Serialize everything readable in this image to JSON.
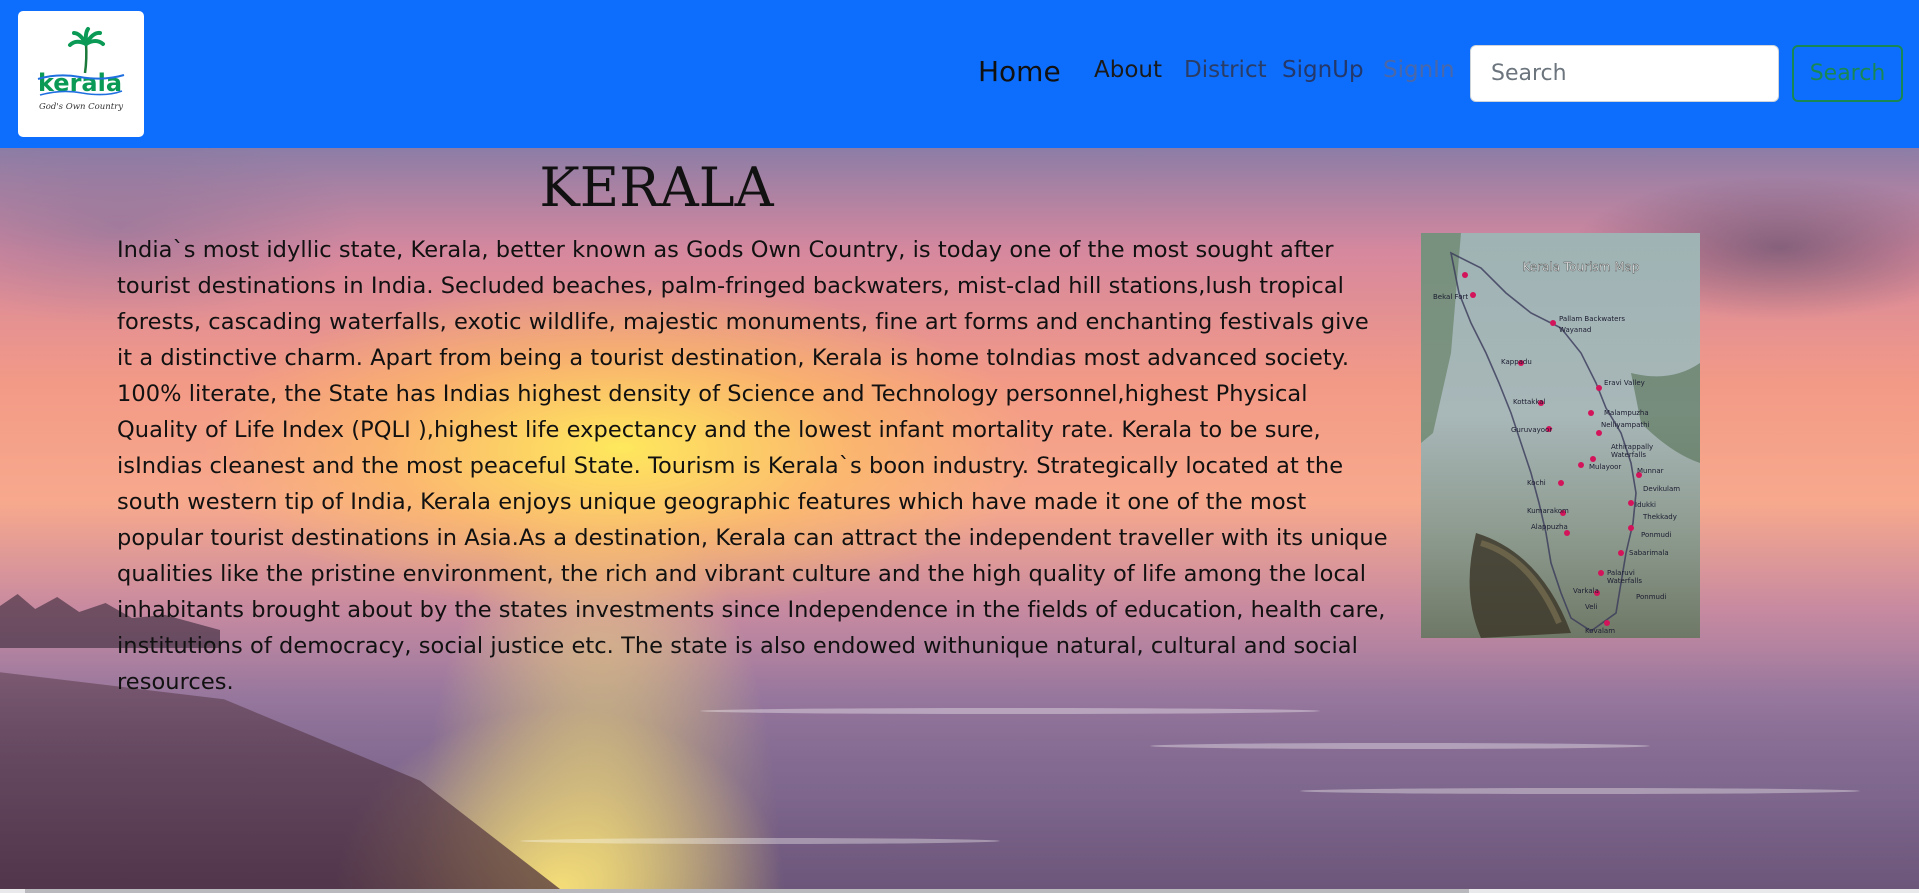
{
  "navbar": {
    "logo": {
      "text": "kerala",
      "tagline": "God's Own Country"
    },
    "links": {
      "home": "Home",
      "about": "About",
      "district": "District",
      "signup": "SignUp",
      "signin": "SignIn"
    },
    "search": {
      "placeholder": "Search",
      "value": "",
      "button_label": "Search"
    },
    "background_color": "#0d6efd"
  },
  "main": {
    "title": "KERALA",
    "description": "India`s most idyllic state, Kerala, better known as Gods Own Country, is today one of the most sought after tourist destinations in India. Secluded beaches, palm-fringed backwaters, mist-clad hill stations,lush tropical forests, cascading waterfalls, exotic wildlife, majestic monuments, fine art forms and enchanting festivals give it a distinctive charm. Apart from being a tourist destination, Kerala is home toIndias most advanced society. 100% literate, the State has Indias highest density of Science and Technology personnel,highest Physical Quality of Life Index (PQLI ),highest life expectancy and the lowest infant mortality rate. Kerala to be sure, isIndias cleanest and the most peaceful State. Tourism is Kerala`s boon industry. Strategically located at the south western tip of India, Kerala enjoys unique geographic features which have made it one of the most popular tourist destinations in Asia.As a destination, Kerala can attract the independent traveller with its unique qualities like the pristine environment, the rich and vibrant culture and the high quality of life among the local inhabitants brought about by the states investments since Independence in the fields of education, health care, institutions of democracy, social justice etc. The state is also endowed withunique natural, cultural and social resources.",
    "map": {
      "title": "Kerala Tourism Map",
      "places": [
        "Bekal Fort",
        "Pallam Backwaters",
        "Wayanad",
        "Kappadu",
        "Kottakkal",
        "Guruvayoor",
        "Munnar",
        "Eravi Valley",
        "Malampuzha",
        "Nelliyampathi",
        "Athirappally Waterfalls",
        "Mulayoor",
        "Munnar",
        "Devikulam",
        "Kochi",
        "Idukki",
        "Thekkady",
        "Kumarakom",
        "Ponmudi",
        "Alappuzha",
        "Sabarimala",
        "Palaruvi Waterfalls",
        "Ponmudi",
        "Varkala",
        "Veli",
        "Kovalam"
      ]
    }
  },
  "icons": {
    "logo": "kerala-logo-icon",
    "palm": "palm-tree-icon"
  }
}
